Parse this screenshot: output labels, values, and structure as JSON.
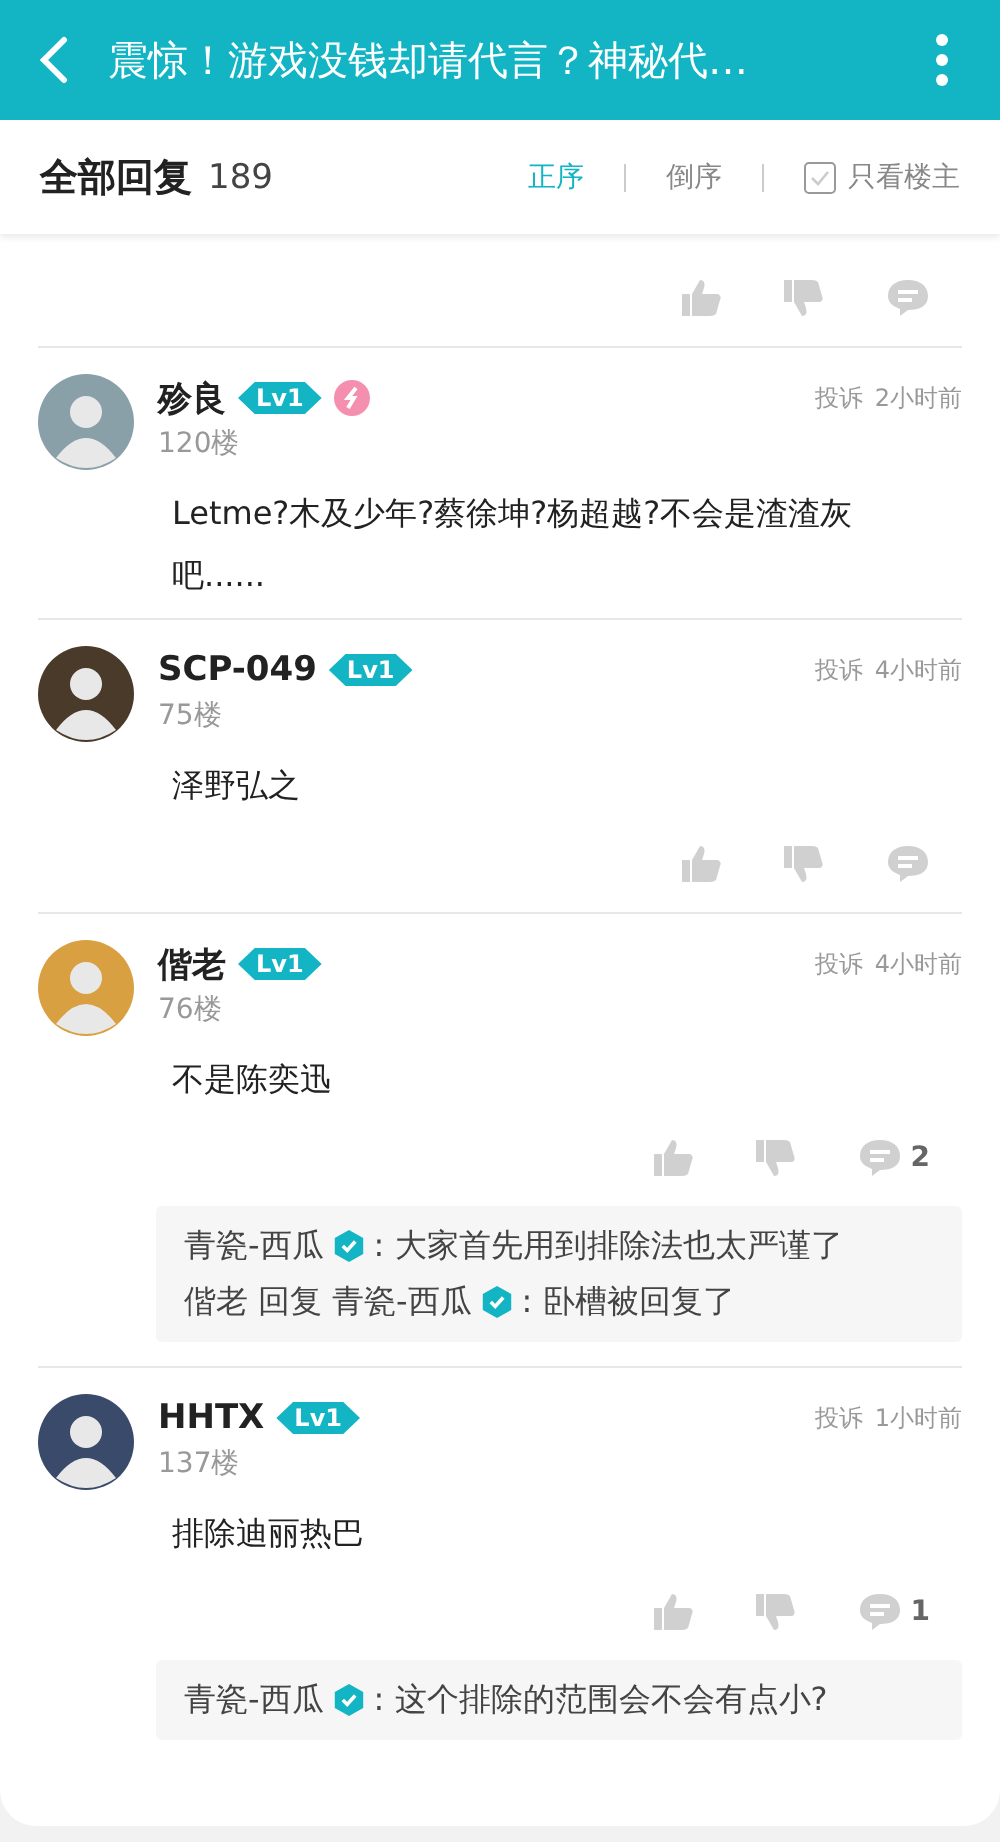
{
  "header": {
    "title": "震惊！游戏没钱却请代言？神秘代…"
  },
  "sort_bar": {
    "title": "全部回复",
    "count": "189",
    "options": [
      {
        "label": "正序",
        "selected": true
      },
      {
        "label": "倒序",
        "selected": false
      }
    ],
    "owner_only": {
      "label": "只看楼主",
      "checked": false
    }
  },
  "comments": [
    {
      "kind": "cut",
      "actions": true
    },
    {
      "kind": "full",
      "name": "殄良",
      "level": "Lv1",
      "medal": true,
      "floor": "120楼",
      "report": "投诉",
      "time": "2小时前",
      "text": "Letme?木及少年?蔡徐坤?杨超越?不会是渣渣灰吧......",
      "actions": false
    },
    {
      "kind": "full",
      "name": "SCP-049",
      "level": "Lv1",
      "medal": false,
      "floor": "75楼",
      "report": "投诉",
      "time": "4小时前",
      "text": "泽野弘之",
      "actions": true
    },
    {
      "kind": "full",
      "name": "偕老",
      "level": "Lv1",
      "medal": false,
      "floor": "76楼",
      "report": "投诉",
      "time": "4小时前",
      "text": "不是陈奕迅",
      "actions": true,
      "reply_count": "2",
      "replies": [
        {
          "author": "青瓷-西瓜",
          "text": ": 大家首先用到排除法也太严谨了"
        },
        {
          "author": "偕老",
          "reply_word": "回复",
          "target": "青瓷-西瓜",
          "text": ": 卧槽被回复了"
        }
      ]
    },
    {
      "kind": "full",
      "name": "HHTX",
      "level": "Lv1",
      "medal": false,
      "floor": "137楼",
      "report": "投诉",
      "time": "1小时前",
      "text": "排除迪丽热巴",
      "actions": true,
      "reply_count": "1",
      "replies": [
        {
          "author": "青瓷-西瓜",
          "text": ": 这个排除的范围会不会有点小?"
        }
      ]
    }
  ]
}
